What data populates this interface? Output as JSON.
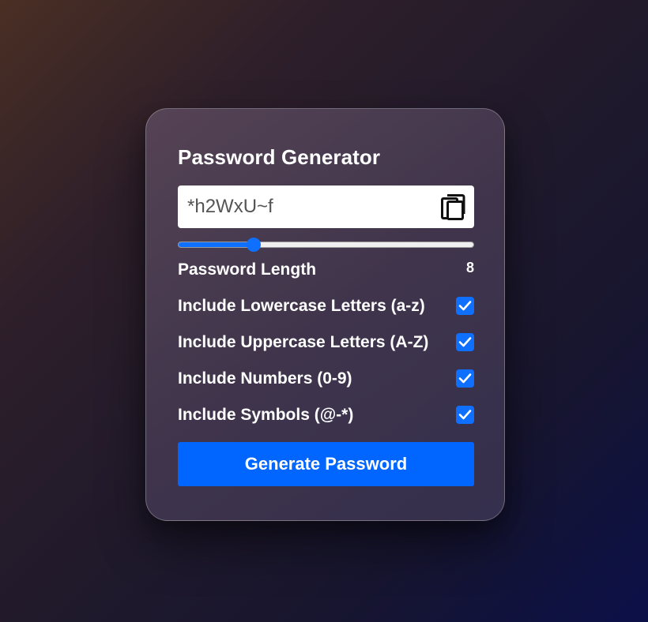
{
  "app": {
    "title": "Password Generator"
  },
  "password": {
    "value": "*h2WxU~f",
    "copy_icon": "copy-icon"
  },
  "length": {
    "label": "Password Length",
    "value": "8",
    "slider_fraction": 0.255
  },
  "options": [
    {
      "label": "Include Lowercase Letters (a-z)",
      "checked": true
    },
    {
      "label": "Include Uppercase Letters (A-Z)",
      "checked": true
    },
    {
      "label": "Include Numbers (0-9)",
      "checked": true
    },
    {
      "label": "Include Symbols (@-*)",
      "checked": true
    }
  ],
  "actions": {
    "generate_label": "Generate Password"
  },
  "colors": {
    "accent": "#0f6fff",
    "button": "#0066ff"
  }
}
